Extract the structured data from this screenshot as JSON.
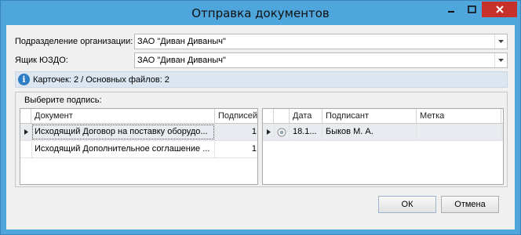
{
  "window": {
    "title": "Отправка документов"
  },
  "form": {
    "org_unit_label": "Подразделение организации:",
    "org_unit_value": "ЗАО \"Диван Диваныч\"",
    "mailbox_label": "Ящик ЮЗДО:",
    "mailbox_value": "ЗАО \"Диван Диваныч\""
  },
  "info": {
    "text": "Карточек: 2 / Основных файлов: 2"
  },
  "signature_group": {
    "title": "Выберите подпись:"
  },
  "documents_grid": {
    "columns": [
      "Документ",
      "Подписей"
    ],
    "rows": [
      {
        "document": "Исходящий Договор на поставку оборудо...",
        "signatures": "1"
      },
      {
        "document": "Исходящий Дополнительное соглашение ...",
        "signatures": "1"
      }
    ]
  },
  "signers_grid": {
    "columns": [
      "",
      "Дата",
      "Подписант",
      "Метка"
    ],
    "rows": [
      {
        "date": "18.1...",
        "signer": "Быков М. А.",
        "mark": ""
      }
    ]
  },
  "buttons": {
    "ok": "ОК",
    "cancel": "Отмена"
  },
  "colors": {
    "titlebar": "#4fa6dd",
    "close_button": "#c7312b",
    "info_bar": "#dbe6f1"
  }
}
